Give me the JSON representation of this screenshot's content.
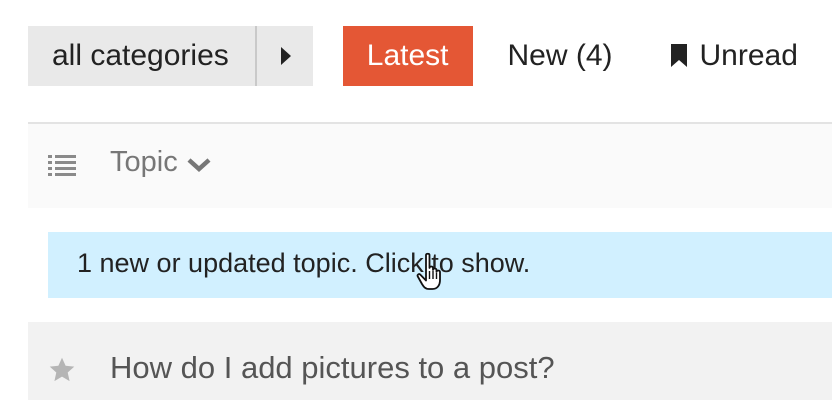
{
  "nav": {
    "category_dropdown": {
      "label": "all categories",
      "toggle_icon": "caret-right-icon"
    },
    "tabs": [
      {
        "label": "Latest",
        "active": true
      },
      {
        "label": "New (4)",
        "active": false
      },
      {
        "label": "Unread",
        "active": false,
        "icon": "bookmark-icon"
      }
    ]
  },
  "list_header": {
    "list_icon": "list-icon",
    "column_label": "Topic",
    "sort_icon": "chevron-down-icon"
  },
  "alert": {
    "message": "1 new or updated topic. Click to show."
  },
  "topics": [
    {
      "title": "How do I add pictures to a post?",
      "icon": "star-icon"
    }
  ],
  "cursor": "hand-pointer-cursor",
  "colors": {
    "accent": "#e45735",
    "alert_background": "#d1f0ff",
    "dropdown_background": "#e9e9e9",
    "row_background": "#f2f2f2",
    "header_background": "#fafafa",
    "text": "#222222",
    "muted_text": "#777777",
    "icon_gray": "#b5b5b5"
  }
}
